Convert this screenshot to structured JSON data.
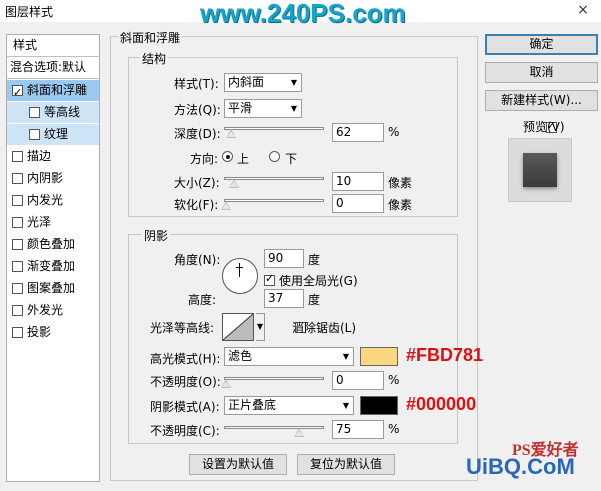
{
  "window": {
    "title": "图层样式",
    "close_icon": "×"
  },
  "watermark": {
    "top": "www.240PS.com",
    "bottom": "UiBQ.CoM",
    "bottom_small": "PS爱好者"
  },
  "styles_panel": {
    "header": "样式",
    "blend_options": "混合选项:默认",
    "items": [
      {
        "label": "斜面和浮雕",
        "checked": true,
        "state": "selected"
      },
      {
        "label": "等高线",
        "checked": false,
        "state": "sub"
      },
      {
        "label": "纹理",
        "checked": false,
        "state": "sub"
      },
      {
        "label": "描边",
        "checked": false
      },
      {
        "label": "内阴影",
        "checked": false
      },
      {
        "label": "内发光",
        "checked": false
      },
      {
        "label": "光泽",
        "checked": false
      },
      {
        "label": "颜色叠加",
        "checked": false
      },
      {
        "label": "渐变叠加",
        "checked": false
      },
      {
        "label": "图案叠加",
        "checked": false
      },
      {
        "label": "外发光",
        "checked": false
      },
      {
        "label": "投影",
        "checked": false
      }
    ]
  },
  "bevel": {
    "title": "斜面和浮雕",
    "structure": {
      "title": "结构",
      "style_label": "样式(T):",
      "style_value": "内斜面",
      "technique_label": "方法(Q):",
      "technique_value": "平滑",
      "depth_label": "深度(D):",
      "depth_value": "62",
      "depth_unit": "%",
      "direction_label": "方向:",
      "dir_up": "上",
      "dir_down": "下",
      "direction_selected": "上",
      "size_label": "大小(Z):",
      "size_value": "10",
      "size_unit": "像素",
      "soften_label": "软化(F):",
      "soften_value": "0",
      "soften_unit": "像素"
    },
    "shading": {
      "title": "阴影",
      "angle_label": "角度(N):",
      "angle_value": "90",
      "angle_unit": "度",
      "global_light_label": "使用全局光(G)",
      "global_light_checked": true,
      "altitude_label": "高度:",
      "altitude_value": "37",
      "altitude_unit": "度",
      "gloss_contour_label": "光泽等高线:",
      "antialias_label": "消除锯齿(L)",
      "antialias_checked": false,
      "highlight_mode_label": "高光模式(H):",
      "highlight_mode_value": "滤色",
      "highlight_color": "#FBD781",
      "highlight_color_label": "#FBD781",
      "highlight_opacity_label": "不透明度(O):",
      "highlight_opacity_value": "0",
      "highlight_opacity_unit": "%",
      "shadow_mode_label": "阴影模式(A):",
      "shadow_mode_value": "正片叠底",
      "shadow_color": "#000000",
      "shadow_color_label": "#000000",
      "shadow_opacity_label": "不透明度(C):",
      "shadow_opacity_value": "75",
      "shadow_opacity_unit": "%"
    },
    "make_default": "设置为默认值",
    "reset_default": "复位为默认值"
  },
  "buttons": {
    "ok": "确定",
    "cancel": "取消",
    "new_style": "新建样式(W)..."
  },
  "preview": {
    "label": "预览(V)",
    "checked": true
  }
}
